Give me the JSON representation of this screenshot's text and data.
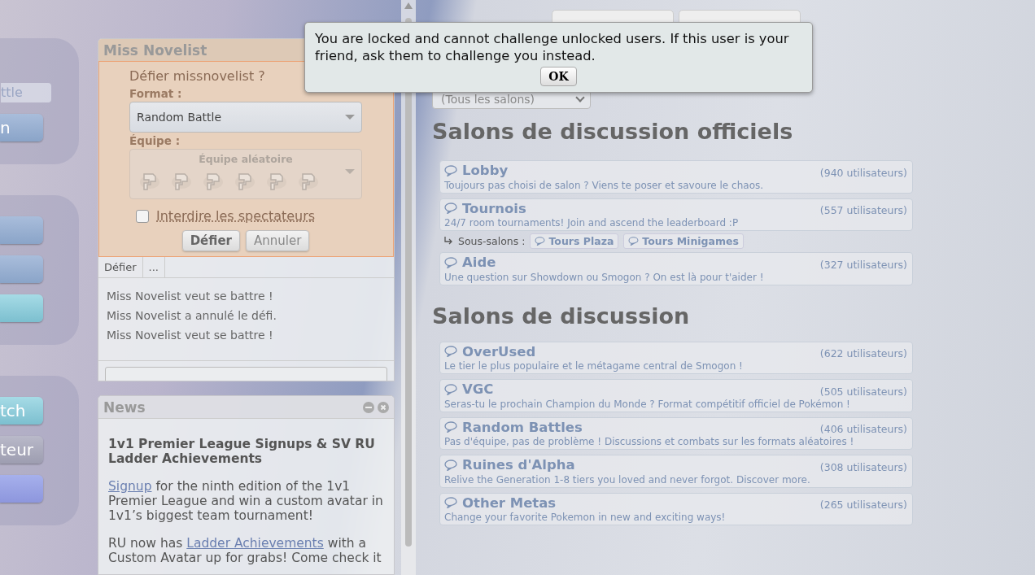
{
  "sidebar": {
    "format_field": {
      "value": "ttle"
    },
    "top_button": {
      "label": "n"
    },
    "bottom_buttons": [
      {
        "label": "tch",
        "kind": "teal"
      },
      {
        "label": "teur",
        "kind": "grey"
      }
    ]
  },
  "challenge": {
    "title": "Miss Novelist",
    "prompt": "Défier missnovelist ?",
    "format_label": "Format :",
    "format_value": "Random Battle",
    "team_label": "Équipe :",
    "team_value": "Équipe aléatoire",
    "team_disabled": true,
    "spectators": {
      "label": "Interdire les spectateurs",
      "checked": false
    },
    "buttons": [
      "Défier",
      "Annuler"
    ],
    "tabs": [
      "Défier",
      "..."
    ],
    "messages": [
      "Miss Novelist veut se battre !",
      "Miss Novelist a annulé le défi.",
      "Miss Novelist veut se battre !"
    ]
  },
  "news": {
    "title": "News",
    "headline": "1v1 Premier League Signups & SV RU Ladder Achievements",
    "paragraphs": [
      [
        {
          "text": "Signup",
          "link": true
        },
        {
          "text": " for the ninth edition of the 1v1 Premier League and win a custom avatar in 1v1’s biggest team tournament!",
          "link": false
        }
      ],
      [
        {
          "text": "RU now has ",
          "link": false
        },
        {
          "text": "Ladder Achievements",
          "link": true
        },
        {
          "text": " with a Custom Avatar up for grabs! Come check it",
          "link": false
        }
      ]
    ]
  },
  "rooms": {
    "filter": "(Tous les salons)",
    "sections": [
      {
        "title": "Salons de discussion officiels",
        "rooms": [
          {
            "name": "Lobby",
            "users": "(940 utilisateurs)",
            "description": "Toujours pas choisi de salon ? Viens te poser et savoure le chaos."
          },
          {
            "name": "Tournois",
            "users": "(557 utilisateurs)",
            "description": "24/7 room tournaments! Join and ascend the leaderboard :P",
            "subrooms": {
              "label": "Sous-salons :",
              "items": [
                "Tours Plaza",
                "Tours Minigames"
              ]
            }
          },
          {
            "name": "Aide",
            "users": "(327 utilisateurs)",
            "description": "Une question sur Showdown ou Smogon ? On est là pour t'aider !"
          }
        ]
      },
      {
        "title": "Salons de discussion",
        "rooms": [
          {
            "name": "OverUsed",
            "users": "(622 utilisateurs)",
            "description": "Le tier le plus populaire et le métagame central de Smogon !"
          },
          {
            "name": "VGC",
            "users": "(505 utilisateurs)",
            "description": "Seras-tu le prochain Champion du Monde ? Format compétitif officiel de Pokémon !"
          },
          {
            "name": "Random Battles",
            "users": "(406 utilisateurs)",
            "description": "Pas d'équipe, pas de problème ! Discussions et combats sur les formats aléatoires !"
          },
          {
            "name": "Ruines d'Alpha",
            "users": "(308 utilisateurs)",
            "description": "Relive the Generation 1-8 tiers you loved and never forgot. Discover more."
          },
          {
            "name": "Other Metas",
            "users": "(265 utilisateurs)",
            "description": "Change your favorite Pokemon in new and exciting ways!"
          }
        ]
      }
    ]
  },
  "dialog": {
    "message": "You are locked and cannot challenge unlocked users. If this user is your friend, ask them to challenge you instead.",
    "button": "OK"
  }
}
